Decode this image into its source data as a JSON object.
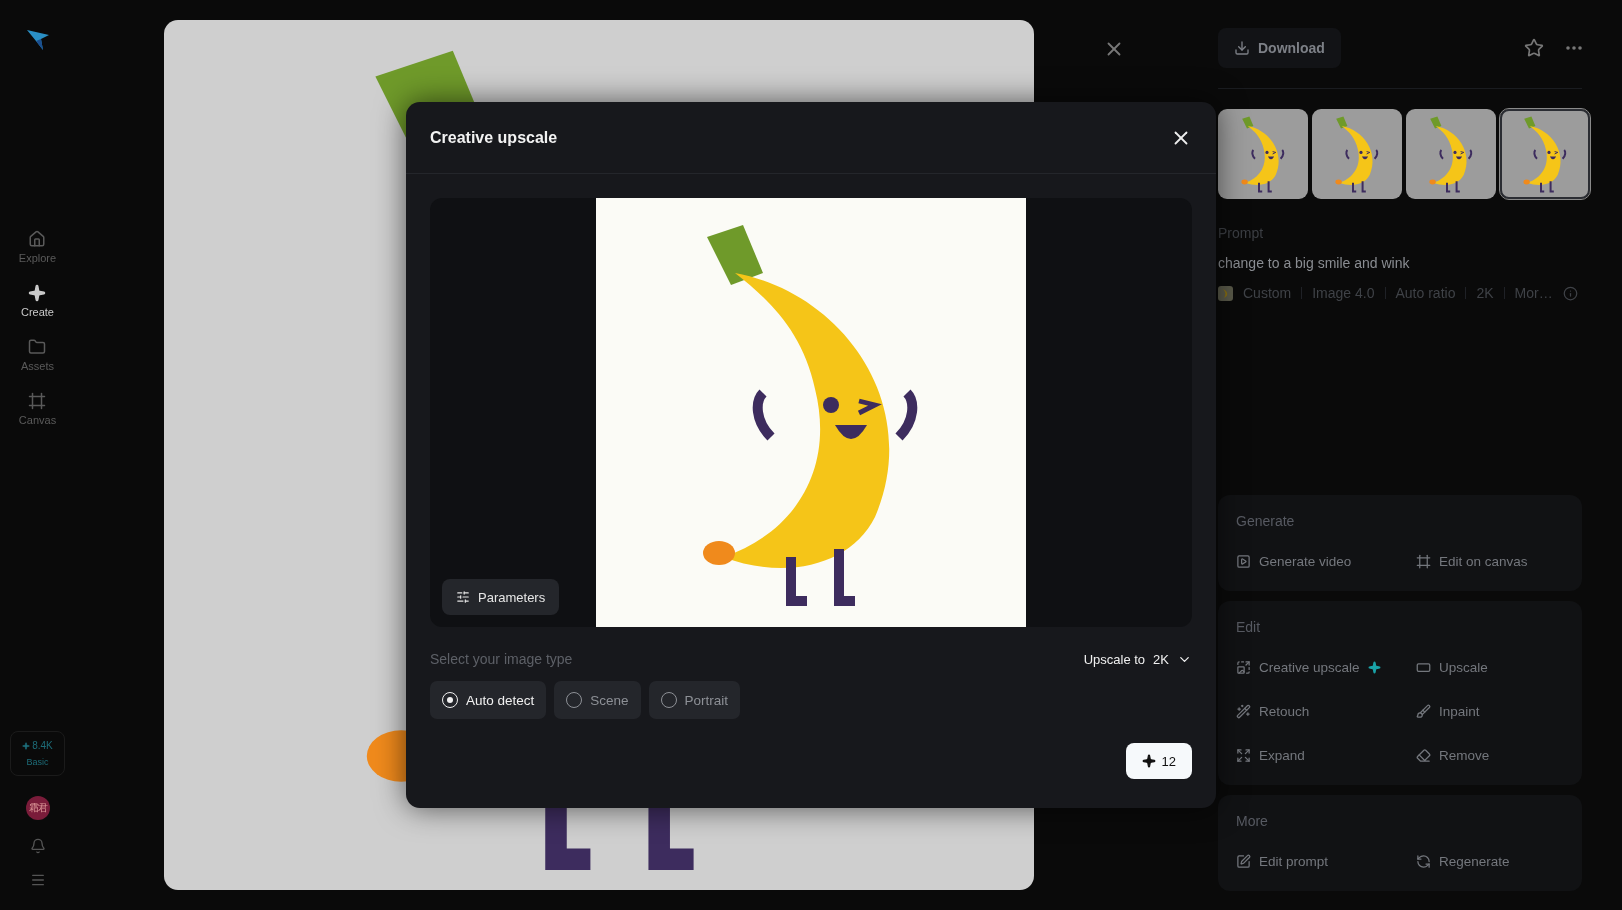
{
  "sidebar": {
    "nav": [
      {
        "label": "Explore",
        "kind": "home",
        "selected": false
      },
      {
        "label": "Create",
        "kind": "create",
        "selected": true
      },
      {
        "label": "Assets",
        "kind": "folder",
        "selected": false
      },
      {
        "label": "Canvas",
        "kind": "canvas",
        "selected": false
      }
    ],
    "credits": {
      "amount": "8.4K",
      "plan": "Basic"
    },
    "avatar": "霜君"
  },
  "panel": {
    "download": "Download",
    "thumbnails": [
      {
        "selected": false
      },
      {
        "selected": false
      },
      {
        "selected": false
      },
      {
        "selected": true
      }
    ],
    "prompt_label": "Prompt",
    "prompt": "change to a big smile and wink",
    "meta": [
      "Custom",
      "Image 4.0",
      "Auto ratio",
      "2K",
      "Mor…"
    ],
    "sections": [
      {
        "title": "Generate",
        "actions": [
          {
            "label": "Generate video",
            "kind": "video",
            "sparkle": false
          },
          {
            "label": "Edit on canvas",
            "kind": "canvas",
            "sparkle": false
          }
        ]
      },
      {
        "title": "Edit",
        "actions": [
          {
            "label": "Creative upscale",
            "kind": "creative",
            "sparkle": true
          },
          {
            "label": "Upscale",
            "kind": "upscale",
            "sparkle": false
          },
          {
            "label": "Retouch",
            "kind": "retouch",
            "sparkle": false
          },
          {
            "label": "Inpaint",
            "kind": "inpaint",
            "sparkle": false
          },
          {
            "label": "Expand",
            "kind": "expand",
            "sparkle": false
          },
          {
            "label": "Remove",
            "kind": "remove",
            "sparkle": false
          }
        ]
      },
      {
        "title": "More",
        "actions": [
          {
            "label": "Edit prompt",
            "kind": "prompt",
            "sparkle": false
          },
          {
            "label": "Regenerate",
            "kind": "regenerate",
            "sparkle": false
          }
        ]
      }
    ]
  },
  "modal": {
    "title": "Creative upscale",
    "parameters": "Parameters",
    "type_label": "Select your image type",
    "upscale_label": "Upscale to",
    "upscale_value": "2K",
    "types": [
      {
        "label": "Auto detect",
        "selected": true
      },
      {
        "label": "Scene",
        "selected": false
      },
      {
        "label": "Portrait",
        "selected": false
      }
    ],
    "cost": "12"
  }
}
